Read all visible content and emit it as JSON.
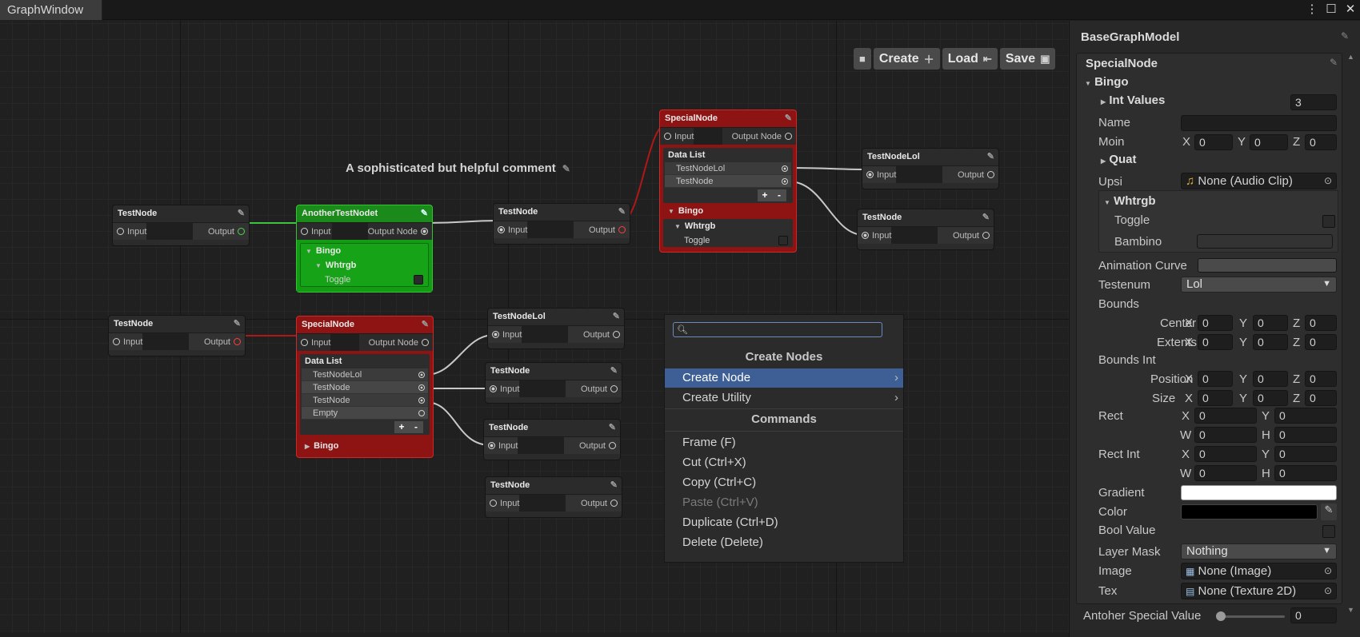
{
  "window": {
    "tab_title": "GraphWindow"
  },
  "toolbar": {
    "create_label": "Create",
    "load_label": "Load",
    "save_label": "Save"
  },
  "comment": {
    "text": "A sophisticated but helpful comment"
  },
  "nodes": {
    "testnode_a": {
      "title": "TestNode",
      "input": "Input",
      "output": "Output"
    },
    "another": {
      "title": "AnotherTestNodet",
      "input": "Input",
      "output": "Output Node",
      "section": "Bingo",
      "subsection": "Whtrgb",
      "toggle_label": "Toggle"
    },
    "testnode_b": {
      "title": "TestNode",
      "input": "Input",
      "output": "Output"
    },
    "special_top": {
      "title": "SpecialNode",
      "input": "Input",
      "output": "Output Node",
      "list_label": "Data List",
      "list": [
        "TestNodeLol",
        "TestNode"
      ],
      "section": "Bingo",
      "subsection": "Whtrgb",
      "toggle_label": "Toggle"
    },
    "testnodelol_top": {
      "title": "TestNodeLol",
      "input": "Input",
      "output": "Output"
    },
    "testnode_c": {
      "title": "TestNode",
      "input": "Input",
      "output": "Output"
    },
    "testnode_d": {
      "title": "TestNode",
      "input": "Input",
      "output": "Output"
    },
    "special_bottom": {
      "title": "SpecialNode",
      "input": "Input",
      "output": "Output Node",
      "list_label": "Data List",
      "list": [
        "TestNodeLol",
        "TestNode",
        "TestNode",
        "Empty"
      ],
      "section": "Bingo"
    },
    "testnodelol_bottom": {
      "title": "TestNodeLol",
      "input": "Input",
      "output": "Output"
    },
    "testnode_e": {
      "title": "TestNode",
      "input": "Input",
      "output": "Output"
    },
    "testnode_f": {
      "title": "TestNode",
      "input": "Input",
      "output": "Output"
    },
    "testnode_g": {
      "title": "TestNode",
      "input": "Input",
      "output": "Output"
    }
  },
  "context_menu": {
    "search_value": "",
    "header_create": "Create Nodes",
    "create_node": "Create Node",
    "create_utility": "Create Utility",
    "header_commands": "Commands",
    "frame": "Frame (F)",
    "cut": "Cut (Ctrl+X)",
    "copy": "Copy (Ctrl+C)",
    "paste": "Paste (Ctrl+V)",
    "duplicate": "Duplicate (Ctrl+D)",
    "delete": "Delete (Delete)"
  },
  "inspector": {
    "title": "BaseGraphModel",
    "node_title": "SpecialNode",
    "bingo": "Bingo",
    "int_values": "Int Values",
    "int_values_count": "3",
    "name_label": "Name",
    "name_value": "",
    "moin_label": "Moin",
    "moin": {
      "x": "0",
      "y": "0",
      "z": "0"
    },
    "quat": "Quat",
    "upsi_label": "Upsi",
    "upsi_value": "None (Audio Clip)",
    "whtrgb": "Whtrgb",
    "toggle_label": "Toggle",
    "bambino_label": "Bambino",
    "animation_curve_label": "Animation Curve",
    "testenum_label": "Testenum",
    "testenum_value": "Lol",
    "bounds_label": "Bounds",
    "center_label": "Center",
    "center": {
      "x": "0",
      "y": "0",
      "z": "0"
    },
    "extents_label": "Extents",
    "extents": {
      "x": "0",
      "y": "0",
      "z": "0"
    },
    "bounds_int_label": "Bounds Int",
    "position_label": "Position",
    "position": {
      "x": "0",
      "y": "0",
      "z": "0"
    },
    "size_label": "Size",
    "size": {
      "x": "0",
      "y": "0",
      "z": "0"
    },
    "rect_label": "Rect",
    "rect": {
      "x": "0",
      "y": "0",
      "w": "0",
      "h": "0"
    },
    "rect_int_label": "Rect Int",
    "rect_int": {
      "x": "0",
      "y": "0",
      "w": "0",
      "h": "0"
    },
    "gradient_label": "Gradient",
    "color_label": "Color",
    "color_value": "#000000",
    "bool_label": "Bool Value",
    "layer_mask_label": "Layer Mask",
    "layer_mask_value": "Nothing",
    "image_label": "Image",
    "image_value": "None (Image)",
    "tex_label": "Tex",
    "tex_value": "None (Texture 2D)",
    "special_value_label": "Antoher Special Value",
    "special_value": "0",
    "slider_fraction": 0
  },
  "axis_labels": {
    "x": "X",
    "y": "Y",
    "z": "Z",
    "w": "W",
    "h": "H"
  },
  "colors": {
    "green_node": "#1a8a1a",
    "red_node": "#8e1414",
    "selection": "#3e5f96",
    "accent_link": "#ffffff"
  }
}
